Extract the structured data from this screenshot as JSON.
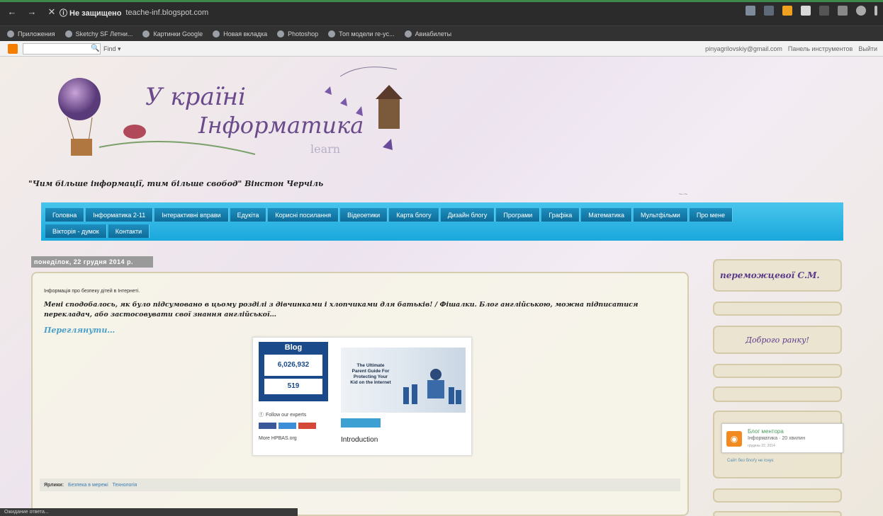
{
  "browser": {
    "security_label": "ⓘ Не защищено",
    "url": "teache-inf.blogspot.com",
    "bookmarks": [
      "Приложения",
      "Sketchy SF Летни...",
      "Картинки Google",
      "Новая вкладка",
      "Photoshop",
      "Топ модели ге-ус...",
      "Авиабилеты"
    ]
  },
  "blogger_bar": {
    "find_label": "Find ▾",
    "user_email": "pinyagrilovskiy@gmail.com",
    "dashboard_label": "Панель инструментов",
    "logout_label": "Выйти"
  },
  "header": {
    "title_line1": "У країні",
    "title_line2": "Інформатика",
    "subtitle_small": "learn",
    "tagline": "\"Чим більше інформації, тим більше свобод\" Вінстон Черчіль"
  },
  "menu": {
    "row1": [
      "Головна",
      "Інформатика 2-11",
      "Інтерактивні вправи",
      "Едукіта",
      "Корисні посилання",
      "Відеоетики",
      "Карта блогу",
      "Дизайн блогу",
      "Програми",
      "Графіка",
      "Математика",
      "Мультфільми",
      "Про мене"
    ],
    "row2": [
      "Вікторія - думок",
      "Контакти"
    ]
  },
  "post": {
    "date": "понеділок, 22 грудня 2014 р.",
    "tags_line": "Інформація про безпеку дітей в Інтернеті.",
    "body": "Мені сподобалось, як було підсумовано в цьому розділі з дівчинками і хлопчиками для батьків! / Фішалки. Блог англійською, можна підписатися перекладач, або застосовувати свої знання англійської…",
    "read_more": "Переглянути…",
    "labels_prefix": "Ярлики:",
    "labels": [
      "Безпека в мережі",
      "Технологія"
    ]
  },
  "embed": {
    "counter_title": "Blog",
    "counter_value1": "6,026,932",
    "counter_value2": "519",
    "follow_label": "Follow our experts",
    "more_label": "More HPBAS.org",
    "thumb_text": "The Ultimate Parent Guide For Protecting Your Kid on the Internet",
    "intro": "Introduction"
  },
  "sidebar": {
    "author": "переможцевої С.М.",
    "greeting": "Доброго ранку!",
    "rss_title": "Блог ментора",
    "rss_sub": "Інформатика · 20 хвилин",
    "rss_date": "грудень 22, 2014",
    "rss_link": "Сайт без блоґу не існує"
  },
  "status": {
    "text": "Ожидание ответа..."
  },
  "colors": {
    "menu_bg": "#1aa8dc",
    "menu_item_bg": "#0f6c99",
    "accent_purple": "#5b3b8a",
    "link_blue": "#4aa0c8",
    "rss_orange": "#f38a1f"
  }
}
